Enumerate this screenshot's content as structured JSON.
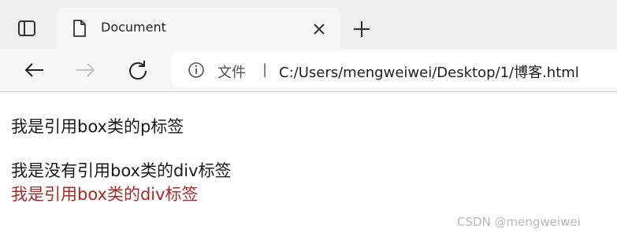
{
  "window": {
    "tab_title": "Document"
  },
  "toolbar": {
    "site_label": "文件",
    "separator": "|",
    "url": "C:/Users/mengweiwei/Desktop/1/博客.html"
  },
  "page": {
    "p_box": "我是引用box类的p标签",
    "div_no_box": "我是没有引用box类的div标签",
    "div_box": "我是引用box类的div标签"
  },
  "watermark": "CSDN @mengweiwei",
  "colors": {
    "box_text": "#a52a2a",
    "tabstrip": "#eeeeee",
    "toolbar": "#f7f7f7"
  },
  "icons": {
    "sidebar": "sidebar-icon",
    "tab": "document-icon",
    "close": "close-icon",
    "new_tab": "plus-icon",
    "back": "arrow-left-icon",
    "forward": "arrow-right-icon",
    "reload": "reload-icon",
    "info": "info-icon"
  }
}
